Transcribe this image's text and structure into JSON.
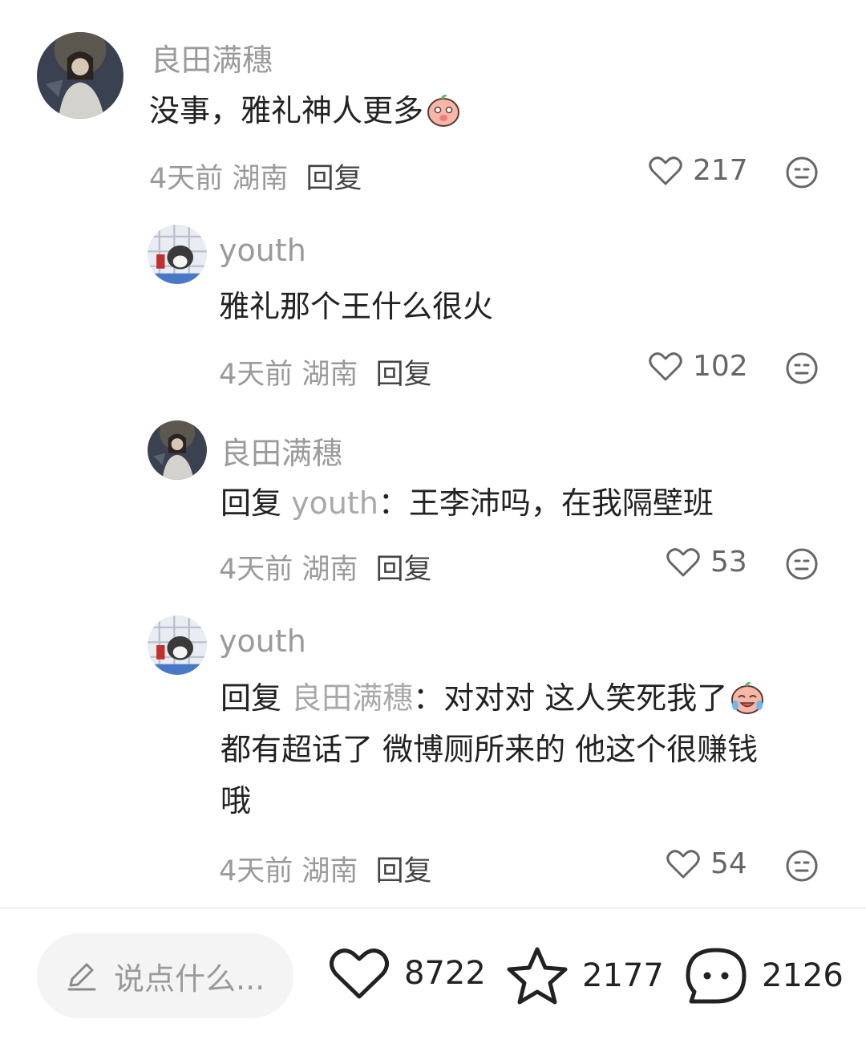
{
  "comments": [
    {
      "author": "良田满穗",
      "text": "没事，雅礼神人更多",
      "emoji": "peach-shy-emoji",
      "time": "4天前",
      "location": "湖南",
      "reply_label": "回复",
      "likes": "217"
    },
    {
      "author": "youth",
      "text": "雅礼那个王什么很火",
      "time": "4天前",
      "location": "湖南",
      "reply_label": "回复",
      "likes": "102"
    },
    {
      "author": "良田满穗",
      "reply_prefix": "回复",
      "reply_to": "youth",
      "text": "：王李沛吗，在我隔壁班",
      "time": "4天前",
      "location": "湖南",
      "reply_label": "回复",
      "likes": "53"
    },
    {
      "author": "youth",
      "reply_prefix": "回复",
      "reply_to": "良田满穗",
      "text_line1": "：对对对 这人笑死我了",
      "emoji": "peach-laugh-cry-emoji",
      "text_line2": "都有超话了 微博厕所来的 他这个很赚钱",
      "text_line3": "哦",
      "time": "4天前",
      "location": "湖南",
      "reply_label": "回复",
      "likes": "54"
    }
  ],
  "bottom_bar": {
    "input_placeholder": "说点什么...",
    "likes": "8722",
    "stars": "2177",
    "comments": "2126"
  },
  "icons": [
    "heart-icon",
    "dislike-face-icon",
    "pencil-icon",
    "star-icon",
    "comment-bubble-icon"
  ]
}
